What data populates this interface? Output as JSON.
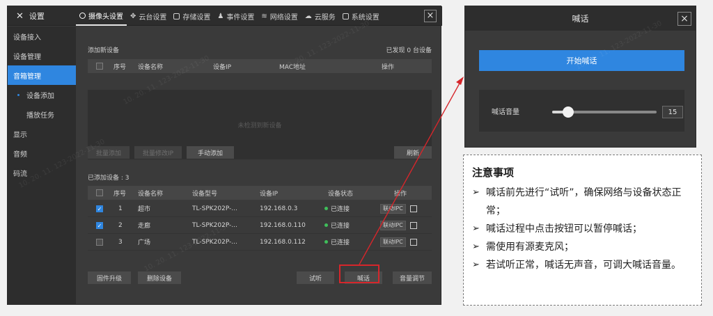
{
  "app": {
    "title": "设置",
    "tabs": [
      {
        "label": "摄像头设置",
        "icon": "camera-icon",
        "active": true
      },
      {
        "label": "云台设置",
        "icon": "ptz-icon",
        "active": false
      },
      {
        "label": "存储设置",
        "icon": "storage-icon",
        "active": false
      },
      {
        "label": "事件设置",
        "icon": "bell-icon",
        "active": false
      },
      {
        "label": "网络设置",
        "icon": "wifi-icon",
        "active": false
      },
      {
        "label": "云服务",
        "icon": "cloud-icon",
        "active": false
      },
      {
        "label": "系统设置",
        "icon": "monitor-icon",
        "active": false
      }
    ],
    "close": "×"
  },
  "sidebar": {
    "items": [
      {
        "label": "设备接入"
      },
      {
        "label": "设备管理"
      },
      {
        "label": "音箱管理"
      },
      {
        "label": "设备添加"
      },
      {
        "label": "播放任务"
      },
      {
        "label": "显示"
      },
      {
        "label": "音频"
      },
      {
        "label": "码流"
      }
    ]
  },
  "add_section": {
    "title": "添加新设备",
    "found": "已发现 0 台设备",
    "columns": [
      "序号",
      "设备名称",
      "设备IP",
      "MAC地址",
      "操作"
    ],
    "empty": "未检测到新设备",
    "buttons": {
      "batch_add": "批量添加",
      "batch_ip": "批量修改IP",
      "manual": "手动添加",
      "refresh": "刷新"
    }
  },
  "added_section": {
    "title": "已添加设备 : 3",
    "columns": [
      "序号",
      "设备名称",
      "设备型号",
      "设备IP",
      "设备状态",
      "操作"
    ],
    "rows": [
      {
        "no": "1",
        "name": "超市",
        "model": "TL-SPK202P-...",
        "ip": "192.168.0.3",
        "status": "已连接",
        "link": "联动IPC",
        "checked": true
      },
      {
        "no": "2",
        "name": "走廊",
        "model": "TL-SPK202P-...",
        "ip": "192.168.0.110",
        "status": "已连接",
        "link": "联动IPC",
        "checked": true
      },
      {
        "no": "3",
        "name": "广场",
        "model": "TL-SPK202P-...",
        "ip": "192.168.0.112",
        "status": "已连接",
        "link": "联动IPC",
        "checked": false
      }
    ],
    "buttons": {
      "upgrade": "固件升级",
      "delete": "删除设备",
      "listen": "试听",
      "shout": "喊话",
      "volume": "音量调节"
    }
  },
  "dialog": {
    "title": "喊话",
    "close": "×",
    "start": "开始喊话",
    "volume_label": "喊话音量",
    "volume_value": "15",
    "volume_fraction": 0.15
  },
  "notes": {
    "title": "注意事项",
    "items": [
      "喊话前先进行“试听”，确保网络与设备状态正常；",
      "喊话过程中点击按钮可以暂停喊话；",
      "需使用有源麦克风；",
      "若试听正常，喊话无声音，可调大喊话音量。"
    ]
  },
  "watermark": "10. 20. 11. 123-2022-11-30",
  "colors": {
    "accent": "#2f86e0",
    "highlight": "#d6262b",
    "status_ok": "#3fbf5a"
  }
}
